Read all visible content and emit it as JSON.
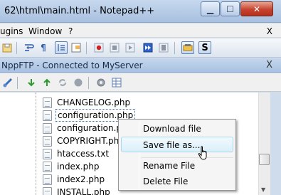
{
  "window": {
    "title": "62\\html\\main.html - Notepad++",
    "controls": {
      "minimize": "▁",
      "maximize": "☐",
      "close": "✕"
    }
  },
  "menubar": {
    "items": [
      "ugins",
      "Window",
      "?"
    ],
    "close": "X"
  },
  "toolbar1": {
    "icons": [
      "save-all-icon",
      "wrap-icon",
      "show-symbols-icon",
      "indent-guide-icon",
      "doc-map-icon",
      "record-macro-icon",
      "stop-macro-icon",
      "play-macro-icon",
      "run-multiple-icon",
      "save-macro-icon",
      "ftp-icon",
      "spell-check-icon"
    ],
    "spell_label": "S"
  },
  "panel": {
    "title": "NppFTP - Connected to MyServer",
    "close": "X"
  },
  "toolbar2": {
    "icons": [
      "connect-icon",
      "download-icon",
      "upload-icon",
      "refresh-icon",
      "abort-icon",
      "settings-icon",
      "message-window-icon"
    ]
  },
  "files": [
    {
      "name": "CHANGELOG.php"
    },
    {
      "name": "configuration.php"
    },
    {
      "name": "configuration.php"
    },
    {
      "name": "COPYRIGHT.php"
    },
    {
      "name": "htaccess.txt"
    },
    {
      "name": "index.php"
    },
    {
      "name": "index2.php"
    },
    {
      "name": "INSTALL.php"
    }
  ],
  "context_menu": {
    "items": [
      {
        "label": "Download file"
      },
      {
        "label": "Save file as..."
      },
      {
        "label": "Rename File"
      },
      {
        "label": "Delete File"
      }
    ]
  }
}
